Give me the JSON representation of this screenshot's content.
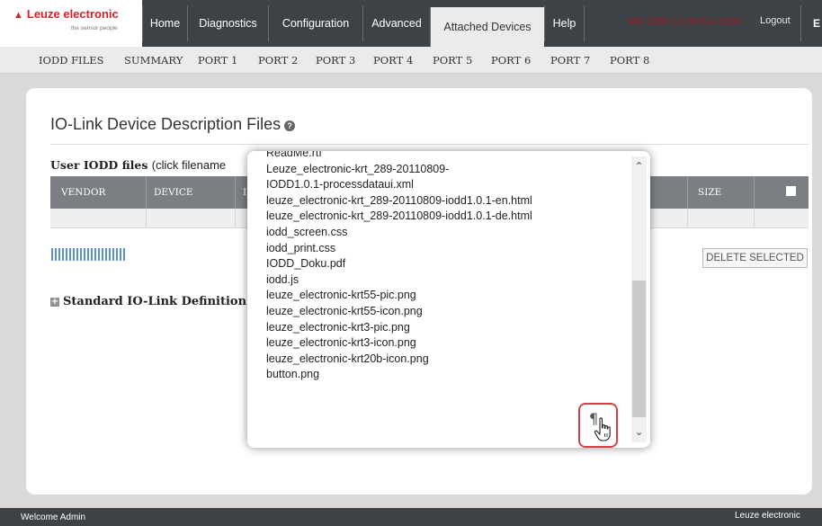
{
  "header": {
    "logo_text": "Leuze electronic",
    "logo_tagline": "the sensor people",
    "tabs": [
      {
        "label": "Home"
      },
      {
        "label": "Diagnostics"
      },
      {
        "label": "Configuration"
      },
      {
        "label": "Advanced"
      },
      {
        "label": "Attached Devices",
        "active": true
      },
      {
        "label": "Help"
      }
    ],
    "device_id": "MD-2580-12-8K/L4-283K",
    "logout_label": "Logout",
    "language_label": "E"
  },
  "subnav": {
    "items": [
      "IODD FILES",
      "SUMMARY",
      "PORT 1",
      "PORT 2",
      "PORT 3",
      "PORT 4",
      "PORT 5",
      "PORT 6",
      "PORT 7",
      "PORT 8"
    ]
  },
  "main": {
    "title": "IO-Link Device Description Files",
    "user_iodd_heading": "User IODD files",
    "user_iodd_note": "(click filename",
    "table": {
      "columns": [
        "VENDOR",
        "DEVICE",
        "I",
        "SIZE"
      ]
    },
    "delete_label": "DELETE SELECTED",
    "standard_defs_label": "Standard IO-Link Definition"
  },
  "popup": {
    "files": [
      "ReadMe.rtf",
      "Leuze_electronic-krt_289-20110809-",
      "IODD1.0.1-processdataui.xml",
      "leuze_electronic-krt_289-20110809-iodd1.0.1-en.html",
      "leuze_electronic-krt_289-20110809-iodd1.0.1-de.html",
      "iodd_screen.css",
      "iodd_print.css",
      "IODD_Doku.pdf",
      "iodd.js",
      "leuze_electronic-krt55-pic.png",
      "leuze_electronic-krt55-icon.png",
      "leuze_electronic-krt3-pic.png",
      "leuze_electronic-krt3-icon.png",
      "leuze_electronic-krt20b-icon.png",
      "button.png"
    ],
    "pilcrow_symbol": "¶"
  },
  "footer": {
    "welcome": "Welcome Admin",
    "brand": "Leuze electronic"
  },
  "colors": {
    "brand_red": "#d2232a",
    "nav_bg": "#3d4247",
    "table_header_bg": "#7b7f83",
    "highlight_border": "#d24345"
  }
}
